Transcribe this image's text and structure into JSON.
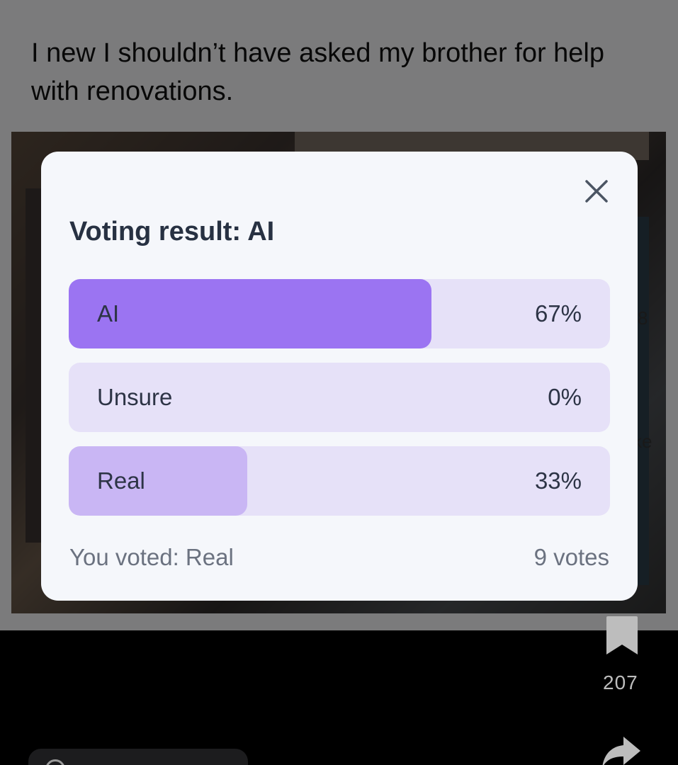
{
  "post": {
    "text": "I new I shouldn’t have asked my brother for help with renovations."
  },
  "side_actions": {
    "partial_count_1": "8",
    "partial_label_2": "ke",
    "bookmark_count": "207"
  },
  "modal": {
    "title": "Voting result: AI",
    "options": [
      {
        "label": "AI",
        "percent": "67%",
        "fraction": 0.67,
        "fill_color": "#9b74f2"
      },
      {
        "label": "Unsure",
        "percent": "0%",
        "fraction": 0.0,
        "fill_color": "#c9b6f4"
      },
      {
        "label": "Real",
        "percent": "33%",
        "fraction": 0.33,
        "fill_color": "#c9b6f4"
      }
    ],
    "you_voted": "You voted: Real",
    "votes": "9 votes"
  },
  "colors": {
    "accent": "#9b74f2",
    "track": "#e6e1f8",
    "secondary_fill": "#c9b6f4"
  }
}
